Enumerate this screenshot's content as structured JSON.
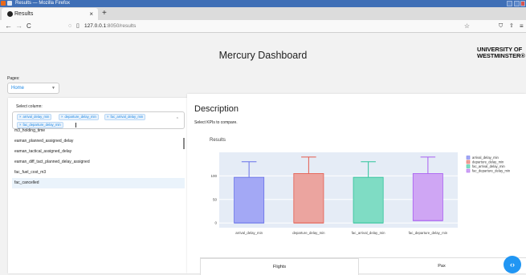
{
  "window": {
    "title": "Results — Mozilla Firefox"
  },
  "browser": {
    "tab_label": "Results",
    "tab_close": "×",
    "new_tab": "+",
    "back": "←",
    "forward": "→",
    "reload": "C",
    "url": "127.0.0.1:8050/results",
    "url_host": "127.0.0.1",
    "url_rest": ":8050/results",
    "bookmark_star": "☆",
    "shield": "◌",
    "lock": "▯",
    "extensions": "⛉",
    "share": "⇧",
    "menu": "≡"
  },
  "header": {
    "title": "Mercury Dashboard",
    "logo_line1": "UNIVERSITY OF",
    "logo_line2": "WESTMINSTER®"
  },
  "pages": {
    "label": "Pages:",
    "selected": "Home"
  },
  "column_select": {
    "label": "Select column:",
    "chips": [
      "arrival_delay_min",
      "departure_delay_min",
      "fac_arrival_delay_min",
      "fac_departure_delay_min"
    ],
    "options": [
      "m3_holding_time",
      "eaman_planned_assigned_delay",
      "eaman_tactical_assigned_delay",
      "eaman_diff_tact_planned_delay_assigned",
      "fac_fuel_cost_m3",
      "fac_cancelled"
    ],
    "highlighted_option": "fac_cancelled"
  },
  "main": {
    "description_title": "Description",
    "description_text": "Select KPIs to compare.",
    "tabs": [
      "Flights",
      "Pax"
    ]
  },
  "chart_data": {
    "type": "box",
    "title": "Results",
    "categories": [
      "arrival_delay_min",
      "departure_delay_min",
      "fac_arrival_delay_min",
      "fac_departure_delay_min"
    ],
    "series": [
      {
        "name": "arrival_delay_min",
        "color": "#a3a8f5",
        "line": "#6670e8",
        "min": 0,
        "q1": 0,
        "median": 0,
        "q3": 97,
        "max": 130
      },
      {
        "name": "departure_delay_min",
        "color": "#eba49f",
        "line": "#e45a4c",
        "min": 0,
        "q1": 0,
        "median": 0,
        "q3": 105,
        "max": 140
      },
      {
        "name": "fac_arrival_delay_min",
        "color": "#7fdcc4",
        "line": "#2fc39a",
        "min": 0,
        "q1": 0,
        "median": 0,
        "q3": 97,
        "max": 130
      },
      {
        "name": "fac_departure_delay_min",
        "color": "#cfa6f4",
        "line": "#a85ef0",
        "min": 0,
        "q1": 5,
        "median": 5,
        "q3": 105,
        "max": 140
      }
    ],
    "y_ticks": [
      0,
      50,
      100
    ],
    "ylim": [
      -10,
      150
    ],
    "legend_position": "right",
    "grid": true
  }
}
